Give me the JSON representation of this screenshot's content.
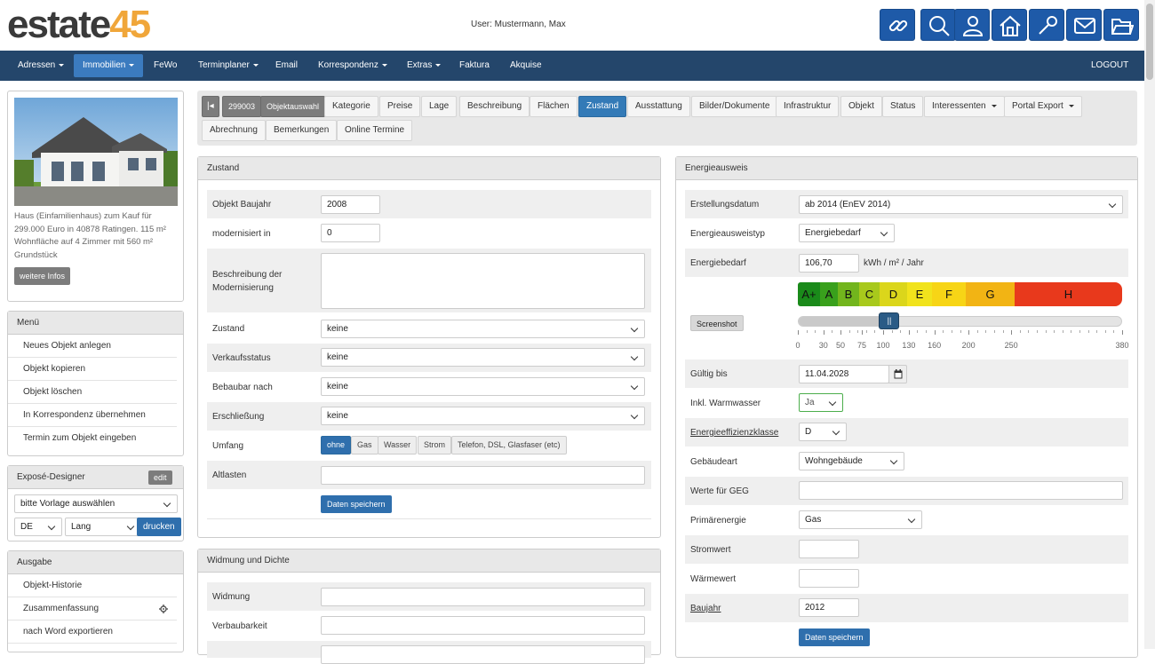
{
  "brand": {
    "part1": "estate",
    "part2": "45"
  },
  "user_text": "User: Mustermann, Max",
  "nav": {
    "adressen": "Adressen",
    "immobilien": "Immobilien",
    "fewo": "FeWo",
    "terminplaner": "Terminplaner",
    "email": "Email",
    "korrespondenz": "Korrespondenz",
    "extras": "Extras",
    "faktura": "Faktura",
    "akquise": "Akquise",
    "logout": "LOGOUT"
  },
  "property": {
    "description": "Haus (Einfamilienhaus) zum Kauf für 299.000 Euro in 40878 Ratingen. 115 m² Wohnfläche auf 4 Zimmer mit 560 m² Grundstück",
    "more_button": "weitere Infos"
  },
  "menu": {
    "title": "Menü",
    "items": [
      "Neues Objekt anlegen",
      "Objekt kopieren",
      "Objekt löschen",
      "In Korrespondenz übernehmen",
      "Termin zum Objekt eingeben"
    ]
  },
  "expose": {
    "title": "Exposé-Designer",
    "edit": "edit",
    "template_select": "bitte Vorlage auswählen",
    "language": "DE",
    "length": "Lang",
    "print": "drucken"
  },
  "ausgabe": {
    "title": "Ausgabe",
    "items": [
      "Objekt-Historie",
      "Zusammenfassung",
      "nach Word exportieren"
    ]
  },
  "tabs": {
    "id": "299003",
    "objektauswahl": "Objektauswahl",
    "kategorie": "Kategorie",
    "preise": "Preise",
    "lage": "Lage",
    "beschreibung": "Beschreibung",
    "flaechen": "Flächen",
    "zustand": "Zustand",
    "ausstattung": "Ausstattung",
    "bilder": "Bilder/Dokumente",
    "infrastruktur": "Infrastruktur",
    "objekt": "Objekt",
    "status": "Status",
    "interessenten": "Interessenten",
    "portal": "Portal Export",
    "abrechnung": "Abrechnung",
    "bemerkungen": "Bemerkungen",
    "online": "Online Termine"
  },
  "zustand": {
    "title": "Zustand",
    "baujahr_label": "Objekt Baujahr",
    "baujahr_value": "2008",
    "modernisiert_label": "modernisiert in",
    "modernisiert_value": "0",
    "beschreibung_label_1": "Beschreibung der",
    "beschreibung_label_2": "Modernisierung",
    "zustand_label": "Zustand",
    "zustand_value": "keine",
    "verkaufsstatus_label": "Verkaufsstatus",
    "verkaufsstatus_value": "keine",
    "bebaubar_label": "Bebaubar nach",
    "bebaubar_value": "keine",
    "erschliessung_label": "Erschließung",
    "erschliessung_value": "keine",
    "umfang_label": "Umfang",
    "umfang_options": [
      "ohne",
      "Gas",
      "Wasser",
      "Strom",
      "Telefon, DSL, Glasfaser (etc)"
    ],
    "altlasten_label": "Altlasten",
    "save": "Daten speichern"
  },
  "widmung": {
    "title": "Widmung und Dichte",
    "widmung_label": "Widmung",
    "verbaubarkeit_label": "Verbaubarkeit"
  },
  "energie": {
    "title": "Energieausweis",
    "erstellungsdatum_label": "Erstellungsdatum",
    "erstellungsdatum_value": "ab 2014 (EnEV 2014)",
    "typ_label": "Energieausweistyp",
    "typ_value": "Energiebedarf",
    "bedarf_label": "Energiebedarf",
    "bedarf_value": "106,70",
    "bedarf_unit": "kWh / m² / Jahr",
    "screenshot": "Screenshot",
    "scale_classes": [
      "A+",
      "A",
      "B",
      "C",
      "D",
      "E",
      "F",
      "G",
      "H"
    ],
    "scale_colors": [
      "#1a8a1a",
      "#39a01c",
      "#72b51d",
      "#a8c91c",
      "#dbd61b",
      "#f1e31c",
      "#f7d516",
      "#f2b414",
      "#e8391c"
    ],
    "slider_value": 106.7,
    "slider_max": 380,
    "slider_handle": "||",
    "tick_labels": [
      "0",
      "30",
      "50",
      "75",
      "100",
      "130",
      "160",
      "200",
      "250",
      "380"
    ],
    "gueltig_label": "Gültig bis",
    "gueltig_value": "11.04.2028",
    "warmwasser_label": "Inkl. Warmwasser",
    "warmwasser_value": "Ja",
    "klasse_label": "Energieeffizienzklasse",
    "klasse_value": "D",
    "gebaeudeart_label": "Gebäudeart",
    "gebaeudeart_value": "Wohngebäude",
    "geg_label": "Werte für GEG",
    "primaer_label": "Primärenergie",
    "primaer_value": "Gas",
    "strom_label": "Stromwert",
    "waerme_label": "Wärmewert",
    "baujahr_label": "Baujahr",
    "baujahr_value": "2012",
    "save": "Daten speichern"
  },
  "colors": {
    "nav": "#24466b",
    "accent": "#337ab7",
    "icon_button": "#1e5aa8",
    "logo_orange": "#f0a63a"
  }
}
